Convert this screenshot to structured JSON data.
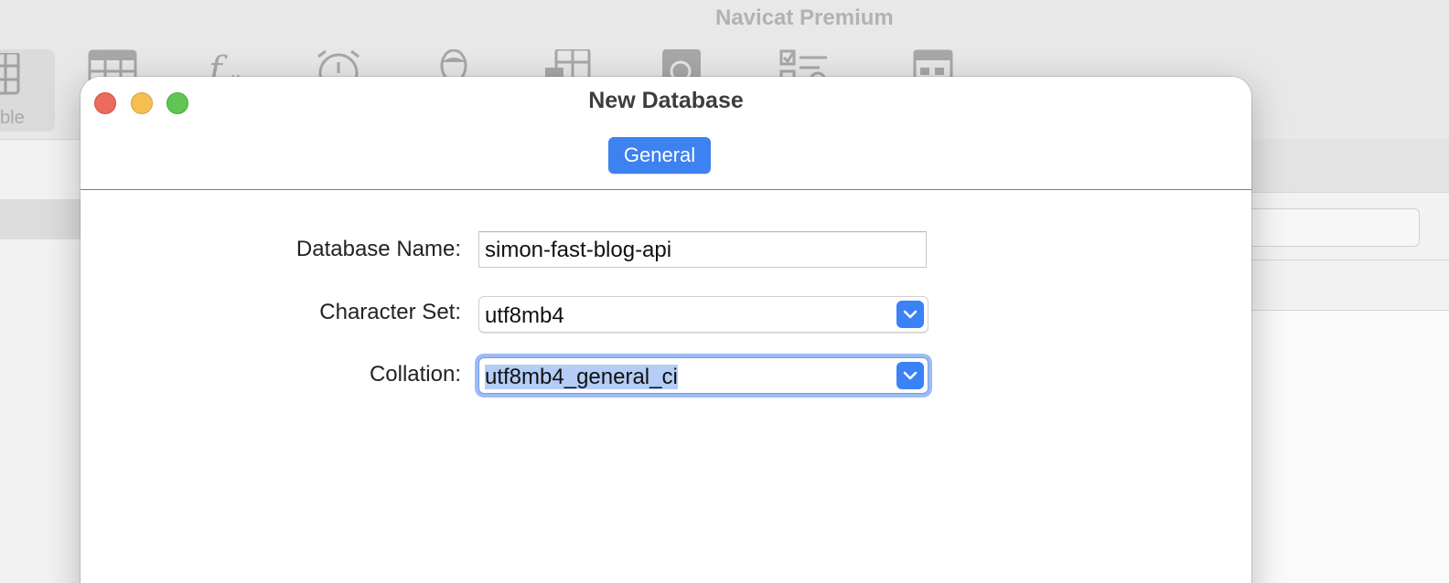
{
  "background_app": {
    "title": "Navicat Premium",
    "selected_tool_label": "ble"
  },
  "dialog": {
    "title": "New Database",
    "tabs": [
      {
        "label": "General",
        "active": true
      }
    ],
    "fields": {
      "database_name": {
        "label": "Database Name:",
        "value": "simon-fast-blog-api"
      },
      "character_set": {
        "label": "Character Set:",
        "value": "utf8mb4"
      },
      "collation": {
        "label": "Collation:",
        "value": "utf8mb4_general_ci",
        "focused": true,
        "text_selected": true
      }
    }
  },
  "colors": {
    "accent": "#3d82f0",
    "focus_ring": "#9dbcf4",
    "selection": "#b4cdf6",
    "close": "#ed6a5e",
    "minimize": "#f5bf4f",
    "maximize": "#61c554"
  }
}
